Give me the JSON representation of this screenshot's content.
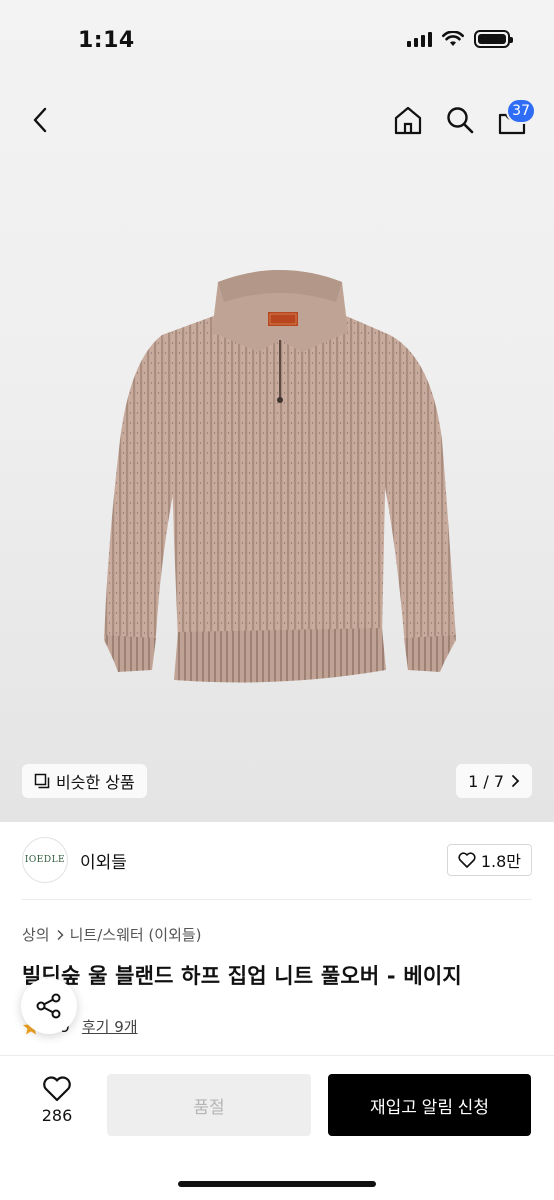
{
  "status_bar": {
    "time": "1:14"
  },
  "nav": {
    "cart_count": "37"
  },
  "gallery": {
    "similar_label": "비슷한 상품",
    "page_indicator": "1 / 7"
  },
  "brand": {
    "logo_text": "IOEDLE",
    "name": "이외들",
    "likes": "1.8만"
  },
  "breadcrumb": {
    "category": "상의",
    "subcategory": "니트/스웨터 (이외들)"
  },
  "product": {
    "title": "빌딘숲 울 블랜드 하프 집업 니트 풀오버 - 베이지"
  },
  "rating": {
    "score": "4.9",
    "review_link": "후기 9개"
  },
  "bottom_bar": {
    "wish_count": "286",
    "soldout_label": "품절",
    "restock_label": "재입고 알림 신청"
  },
  "colors": {
    "accent_badge": "#2f6df6",
    "sweater": "#c9ac9e",
    "cta_bg": "#000000"
  },
  "icons": [
    "back-icon",
    "home-icon",
    "search-icon",
    "cart-icon",
    "similar-icon",
    "chevron-right-icon",
    "heart-icon",
    "share-icon",
    "star-icon"
  ]
}
